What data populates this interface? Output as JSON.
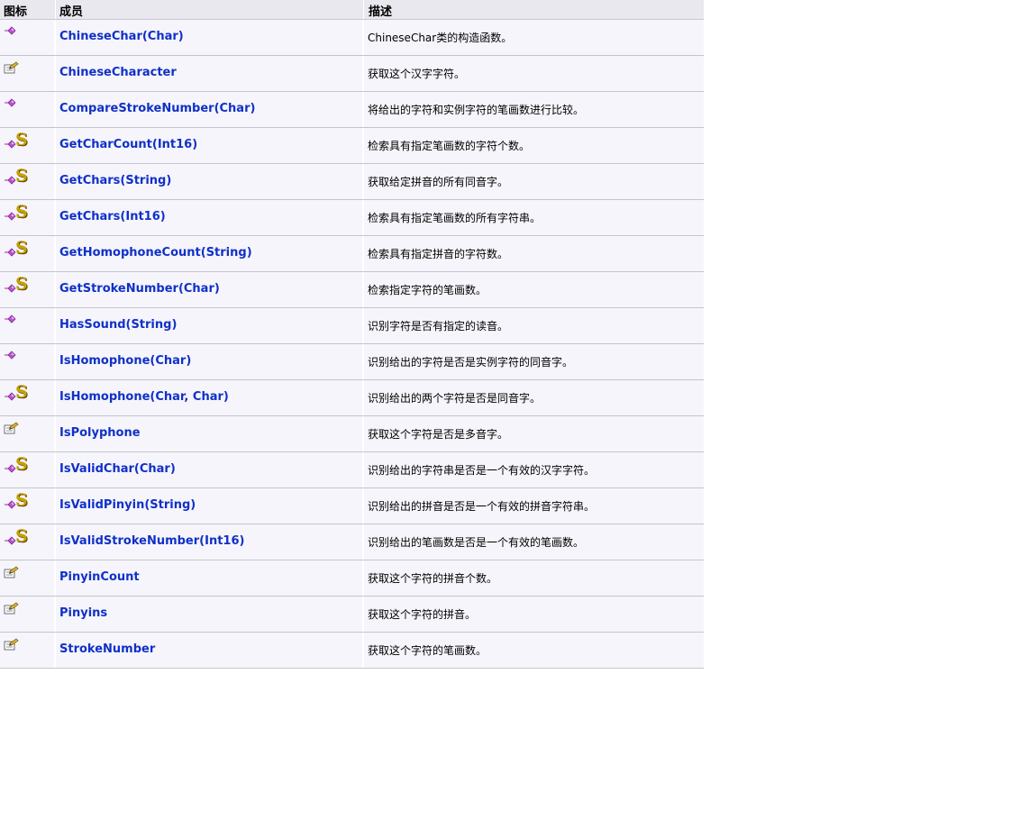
{
  "headers": {
    "icon": "图标",
    "member": "成员",
    "description": "描述"
  },
  "rows": [
    {
      "icons": [
        "method-icon"
      ],
      "name": "ChineseChar(Char)",
      "desc": "ChineseChar类的构造函数。"
    },
    {
      "icons": [
        "property-icon"
      ],
      "name": "ChineseCharacter",
      "desc": "获取这个汉字字符。"
    },
    {
      "icons": [
        "method-icon"
      ],
      "name": "CompareStrokeNumber(Char)",
      "desc": "将给出的字符和实例字符的笔画数进行比较。"
    },
    {
      "icons": [
        "method-icon",
        "static-icon"
      ],
      "name": "GetCharCount(Int16)",
      "desc": "检索具有指定笔画数的字符个数。"
    },
    {
      "icons": [
        "method-icon",
        "static-icon"
      ],
      "name": "GetChars(String)",
      "desc": "获取给定拼音的所有同音字。"
    },
    {
      "icons": [
        "method-icon",
        "static-icon"
      ],
      "name": "GetChars(Int16)",
      "desc": "检索具有指定笔画数的所有字符串。"
    },
    {
      "icons": [
        "method-icon",
        "static-icon"
      ],
      "name": "GetHomophoneCount(String)",
      "desc": "检索具有指定拼音的字符数。"
    },
    {
      "icons": [
        "method-icon",
        "static-icon"
      ],
      "name": "GetStrokeNumber(Char)",
      "desc": "检索指定字符的笔画数。"
    },
    {
      "icons": [
        "method-icon"
      ],
      "name": "HasSound(String)",
      "desc": "识别字符是否有指定的读音。"
    },
    {
      "icons": [
        "method-icon"
      ],
      "name": "IsHomophone(Char)",
      "desc": "识别给出的字符是否是实例字符的同音字。"
    },
    {
      "icons": [
        "method-icon",
        "static-icon"
      ],
      "name": "IsHomophone(Char, Char)",
      "desc": "识别给出的两个字符是否是同音字。"
    },
    {
      "icons": [
        "property-icon"
      ],
      "name": "IsPolyphone",
      "desc": "获取这个字符是否是多音字。"
    },
    {
      "icons": [
        "method-icon",
        "static-icon"
      ],
      "name": "IsValidChar(Char)",
      "desc": "识别给出的字符串是否是一个有效的汉字字符。"
    },
    {
      "icons": [
        "method-icon",
        "static-icon"
      ],
      "name": "IsValidPinyin(String)",
      "desc": "识别给出的拼音是否是一个有效的拼音字符串。"
    },
    {
      "icons": [
        "method-icon",
        "static-icon"
      ],
      "name": "IsValidStrokeNumber(Int16)",
      "desc": "识别给出的笔画数是否是一个有效的笔画数。"
    },
    {
      "icons": [
        "property-icon"
      ],
      "name": "PinyinCount",
      "desc": "获取这个字符的拼音个数。"
    },
    {
      "icons": [
        "property-icon"
      ],
      "name": "Pinyins",
      "desc": "获取这个字符的拼音。"
    },
    {
      "icons": [
        "property-icon"
      ],
      "name": "StrokeNumber",
      "desc": "获取这个字符的笔画数。"
    }
  ],
  "static_marker": "S",
  "colors": {
    "link": "#1030c8",
    "row_bg": "#f5f5fb",
    "header_bg": "#e8e8ee"
  }
}
